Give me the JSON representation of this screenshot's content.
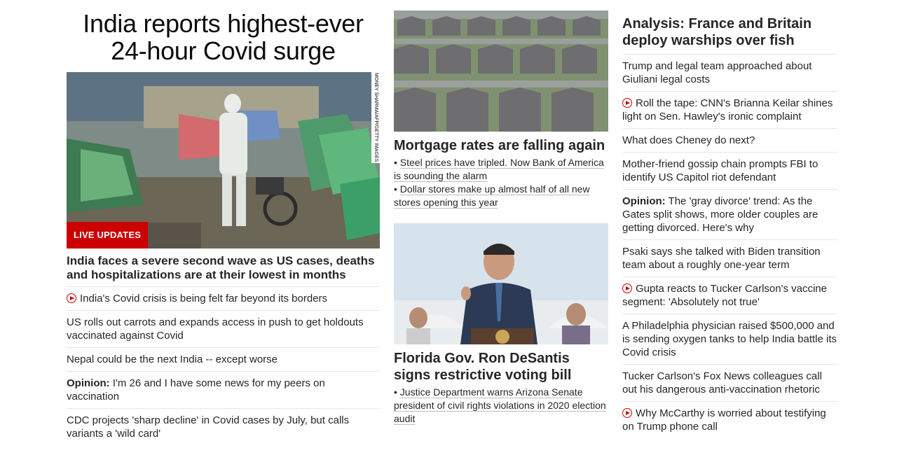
{
  "left": {
    "headline": "India reports highest-ever 24-hour Covid surge",
    "hero_credit": "MONEY SHARMA/AFP/GETTY IMAGES",
    "badge": "LIVE UPDATES",
    "subheadline": "India faces a severe second wave as US cases, deaths and hospitalizations are at their lowest in months",
    "items": [
      {
        "text": "India's Covid crisis is being felt far beyond its borders",
        "video": true,
        "prefix": ""
      },
      {
        "text": "US rolls out carrots and expands access in push to get holdouts vaccinated against Covid",
        "video": false,
        "prefix": ""
      },
      {
        "text": "Nepal could be the next India -- except worse",
        "video": false,
        "prefix": ""
      },
      {
        "text": " I'm 26 and I have some news for my peers on vaccination",
        "video": false,
        "prefix": "Opinion:"
      },
      {
        "text": "CDC projects 'sharp decline' in Covid cases by July, but calls variants a 'wild card'",
        "video": false,
        "prefix": ""
      }
    ]
  },
  "middle": {
    "story1": {
      "title": "Mortgage rates are falling again",
      "bullets": [
        "Steel prices have tripled. Now Bank of America is sounding the alarm",
        "Dollar stores make up almost half of all new stores opening this year"
      ]
    },
    "story2": {
      "title": "Florida Gov. Ron DeSantis signs restrictive voting bill",
      "bullets": [
        "Justice Department warns Arizona Senate president of civil rights violations in 2020 election audit"
      ]
    }
  },
  "right": {
    "headline": "Analysis: France and Britain deploy warships over fish",
    "items": [
      {
        "text": "Trump and legal team approached about Giuliani legal costs",
        "video": false,
        "prefix": ""
      },
      {
        "text": "Roll the tape: CNN's Brianna Keilar shines light on Sen. Hawley's ironic complaint",
        "video": true,
        "prefix": ""
      },
      {
        "text": "What does Cheney do next?",
        "video": false,
        "prefix": ""
      },
      {
        "text": "Mother-friend gossip chain prompts FBI to identify US Capitol riot defendant",
        "video": false,
        "prefix": ""
      },
      {
        "text": " The 'gray divorce' trend: As the Gates split shows, more older couples are getting divorced. Here's why",
        "video": false,
        "prefix": "Opinion:"
      },
      {
        "text": "Psaki says she talked with Biden transition team about a roughly one-year term",
        "video": false,
        "prefix": ""
      },
      {
        "text": "Gupta reacts to Tucker Carlson's vaccine segment: 'Absolutely not true'",
        "video": true,
        "prefix": ""
      },
      {
        "text": "A Philadelphia physician raised $500,000 and is sending oxygen tanks to help India battle its Covid crisis",
        "video": false,
        "prefix": ""
      },
      {
        "text": "Tucker Carlson's Fox News colleagues call out his dangerous anti-vaccination rhetoric",
        "video": false,
        "prefix": ""
      },
      {
        "text": "Why McCarthy is worried about testifying on Trump phone call",
        "video": true,
        "prefix": ""
      }
    ]
  },
  "colors": {
    "accent": "#cc0000",
    "text": "#262626",
    "divider": "#e6e6e6"
  },
  "icons": {
    "video": "play-circle-icon"
  }
}
